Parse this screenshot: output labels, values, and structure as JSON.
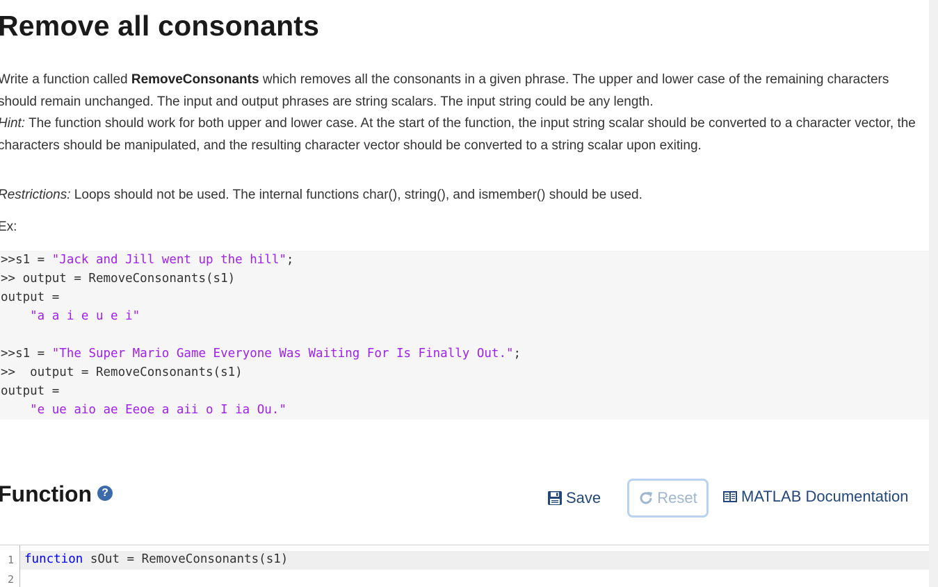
{
  "problem": {
    "title": "Remove all consonants",
    "desc_write": "Write a function called ",
    "func_name": "RemoveConsonants",
    "desc_rest": " which removes all the consonants in a given phrase.  The upper and lower case of the remaining characters should remain unchanged. The input and output phrases are string scalars. The input string could be any length.",
    "hint_label": "Hint:",
    "hint_text": " The function should work for both upper and lower case.  At the start of the function, the input string scalar should be converted to a character vector, the characters should be manipulated, and the resulting character vector should be converted to a string scalar upon exiting.",
    "restrictions_label": "Restrictions:",
    "restrictions_text": "  Loops should not be used.  The internal functions char(), string(), and ismember() should be used.",
    "example_label": "Ex:"
  },
  "example_code": {
    "l1_prefix": ">>s1 = ",
    "l1_str": "\"Jack and Jill went up the hill\"",
    "l1_suffix": ";",
    "l2": ">> output = RemoveConsonants(s1)",
    "l3": "output =",
    "l4_str": "    \"a a i e u e i\"",
    "l5_prefix": ">>s1 = ",
    "l5_str": "\"The Super Mario Game Everyone Was Waiting For Is Finally Out.\"",
    "l5_suffix": ";",
    "l6": ">>  output = RemoveConsonants(s1)",
    "l7": "output =",
    "l8_str": "    \"e ue aio ae Eeoe a aii o I ia Ou.\""
  },
  "function_section": {
    "title": "Function",
    "help_glyph": "?",
    "save_label": "Save",
    "reset_label": "Reset",
    "doc_label": "MATLAB Documentation"
  },
  "editor": {
    "line1_no": "1",
    "line2_no": "2",
    "line1_kw": "function",
    "line1_rest": " sOut = RemoveConsonants(s1)"
  },
  "colors": {
    "string": "#a020f0",
    "keyword": "#0000ff",
    "button": "#23477a",
    "reset_border": "#b9d3ee"
  }
}
